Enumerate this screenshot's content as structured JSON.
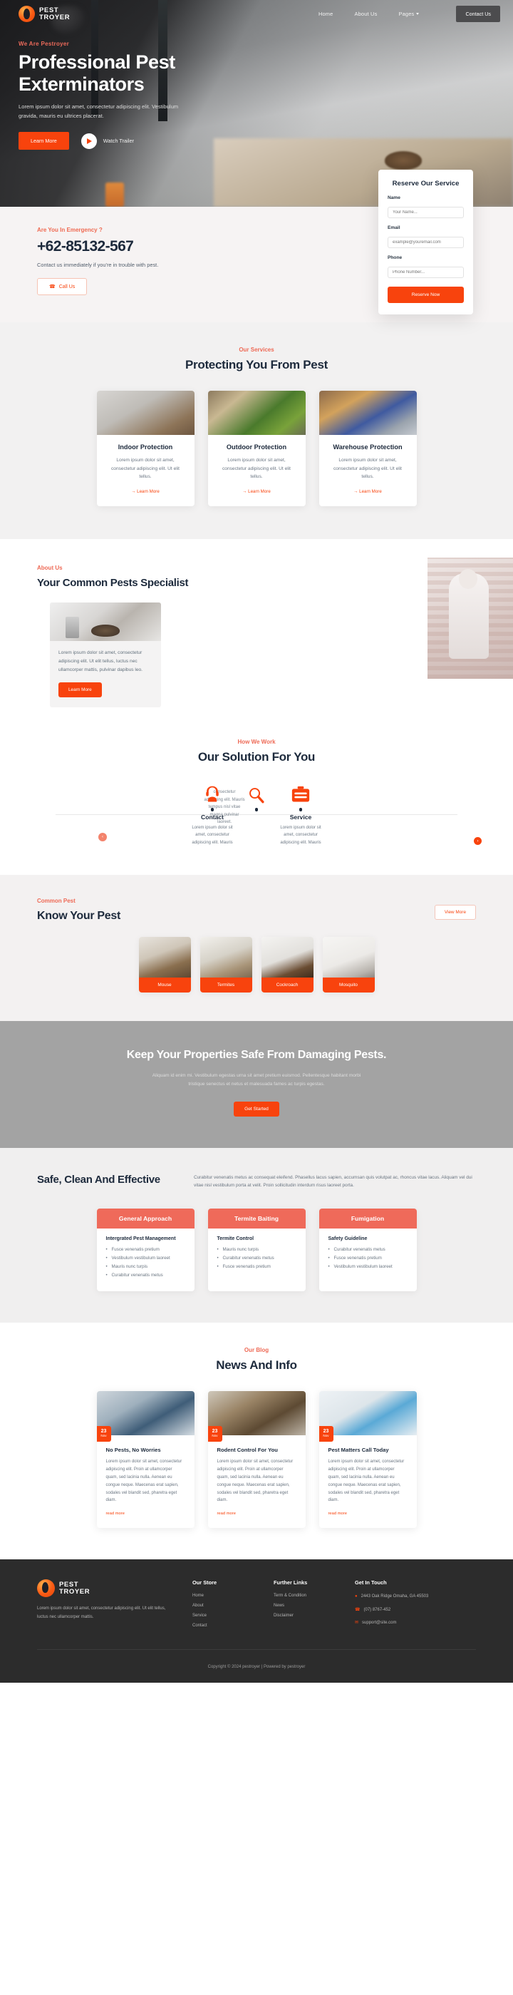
{
  "brand": {
    "line1": "PEST",
    "line2": "TROYER"
  },
  "nav": {
    "items": [
      {
        "label": "Home"
      },
      {
        "label": "About Us"
      },
      {
        "label": "Pages"
      }
    ],
    "cta": "Contact Us"
  },
  "hero": {
    "eyebrow": "We Are Pestroyer",
    "title": "Professional Pest Exterminators",
    "paragraph": "Lorem ipsum dolor sit amet, consectetur adipiscing elit. Vestibulum gravida, mauris eu ultrices placerat.",
    "primary_button": "Learn More",
    "watch_label": "Watch Trailer"
  },
  "emergency": {
    "eyebrow": "Are You In Emergency ?",
    "phone": "+62-85132-567",
    "subtitle": "Contact us immediately if you're in trouble with pest.",
    "call_button": "Call Us"
  },
  "reserve": {
    "title": "Reserve Our Service",
    "fields": [
      {
        "label": "Name",
        "placeholder": "Your Name..."
      },
      {
        "label": "Email",
        "placeholder": "example@youremail.com"
      },
      {
        "label": "Phone",
        "placeholder": "Phone Number..."
      }
    ],
    "submit": "Reserve Now"
  },
  "services": {
    "eyebrow": "Our Services",
    "title": "Protecting You From Pest",
    "items": [
      {
        "name": "Indoor Protection",
        "desc": "Lorem ipsum dolor sit amet, consectetur adipiscing elit. Ut elit tellus.",
        "link": "→ Learn More"
      },
      {
        "name": "Outdoor Protection",
        "desc": "Lorem ipsum dolor sit amet, consectetur adipiscing elit. Ut elit tellus.",
        "link": "→ Learn More"
      },
      {
        "name": "Warehouse Protection",
        "desc": "Lorem ipsum dolor sit amet, consectetur adipiscing elit. Ut elit tellus.",
        "link": "→ Learn More"
      }
    ]
  },
  "about": {
    "eyebrow": "About Us",
    "title": "Your Common Pests Specialist",
    "card_text": "Lorem ipsum dolor sit amet, consectetur adipiscing elit. Ut elit tellus, luctus nec ullamcorper mattis, pulvinar dapibus leo.",
    "button": "Learn More"
  },
  "solution": {
    "eyebrow": "How We Work",
    "title": "Our Solution For You",
    "ghost_text": "consectetur adipiscing elit. Mauris tempus nisl vitae magna pulvinar laoreet.",
    "steps": [
      {
        "name": "Contact",
        "desc": "Lorem ipsum dolor sit amet, consectetur adipiscing elit. Mauris",
        "icon": "support-agent-icon"
      },
      {
        "name": "Service",
        "desc": "Lorem ipsum dolor sit amet, consectetur adipiscing elit. Mauris",
        "icon": "toolbox-icon"
      }
    ]
  },
  "pests": {
    "eyebrow": "Common Pest",
    "title": "Know Your Pest",
    "view_all": "View More",
    "items": [
      {
        "label": "Mouse"
      },
      {
        "label": "Termites"
      },
      {
        "label": "Cockroach"
      },
      {
        "label": "Mosquito"
      }
    ]
  },
  "cta": {
    "title": "Keep Your Properties Safe From Damaging Pests.",
    "subtitle": "Aliquam id enim mi. Vestibulum egestas urna sit amet pretium euismod. Pellentesque habitant morbi tristique senectus et netus et malesuada fames ac turpis egestas.",
    "button": "Get Started"
  },
  "safe": {
    "title": "Safe, Clean And Effective",
    "text": "Curabitur venenatis metus ac consequat eleifend. Phasellus lacus sapien, accumsan quis volutpat ac, rhoncus vitae lacus. Aliquam vel dui vitae nisl vestibulum porta at velit. Proin sollicitudin interdum risus laoreet porta.",
    "cards": [
      {
        "heading": "General Approach",
        "subheading": "Intergrated Pest Management",
        "list": [
          "Fusce venenatis pretium",
          "Vestibulum vestibulum laoreet",
          "Mauris nunc turpis",
          "Curabitur venenatis metus"
        ]
      },
      {
        "heading": "Termite Baiting",
        "subheading": "Termite Control",
        "list": [
          "Mauris nunc turpis",
          "Curabitur venenatis metus",
          "Fusce venenatis pretium"
        ]
      },
      {
        "heading": "Fumigation",
        "subheading": "Safety Guideline",
        "list": [
          "Curabitur venenatis metus",
          "Fusce venenatis pretium",
          "Vestibulum vestibulum laoreet"
        ]
      }
    ]
  },
  "blog": {
    "eyebrow": "Our Blog",
    "title": "News And Info",
    "posts": [
      {
        "day": "23",
        "month": "Nov",
        "title": "No Pests, No Worries",
        "text": "Lorem ipsum dolor sit amet, consectetur adipiscing elit. Proin at ullamcorper quam, sed lacinia nulla. Aenean eu congue neque. Maecenas erat sapien, sodales vel blandit sed, pharetra eget diam.",
        "more": "read more"
      },
      {
        "day": "23",
        "month": "Nov",
        "title": "Rodent Control For You",
        "text": "Lorem ipsum dolor sit amet, consectetur adipiscing elit. Proin at ullamcorper quam, sed lacinia nulla. Aenean eu congue neque. Maecenas erat sapien, sodales vel blandit sed, pharetra eget diam.",
        "more": "read more"
      },
      {
        "day": "23",
        "month": "Nov",
        "title": "Pest Matters Call Today",
        "text": "Lorem ipsum dolor sit amet, consectetur adipiscing elit. Proin at ullamcorper quam, sed lacinia nulla. Aenean eu congue neque. Maecenas erat sapien, sodales vel blandit sed, pharetra eget diam.",
        "more": "read more"
      }
    ]
  },
  "footer": {
    "brand_text": "Lorem ipsum dolor sit amet, consectetur adipiscing elit. Ut elit tellus, luctus nec ullamcorper mattis.",
    "columns": [
      {
        "heading": "Our Store",
        "links": [
          "Home",
          "About",
          "Service",
          "Contact"
        ]
      },
      {
        "heading": "Further Links",
        "links": [
          "Term & Condition",
          "News",
          "Disclaimer"
        ]
      }
    ],
    "contact_heading": "Get In Touch",
    "contact_items": [
      {
        "icon": "map-pin-icon",
        "text": "2443 Oak Ridge Omaha, GA 45503"
      },
      {
        "icon": "phone-icon",
        "text": "(07) 8767-452"
      },
      {
        "icon": "mail-icon",
        "text": "support@site.com"
      }
    ],
    "copyright": "Copyright © 2024 pestroyer | Powered by pestroyer"
  },
  "colors": {
    "accent": "#f8430d",
    "accent_soft": "#ef6a5a",
    "dark": "#1d2a3c",
    "footer_bg": "#2c2c2c"
  }
}
